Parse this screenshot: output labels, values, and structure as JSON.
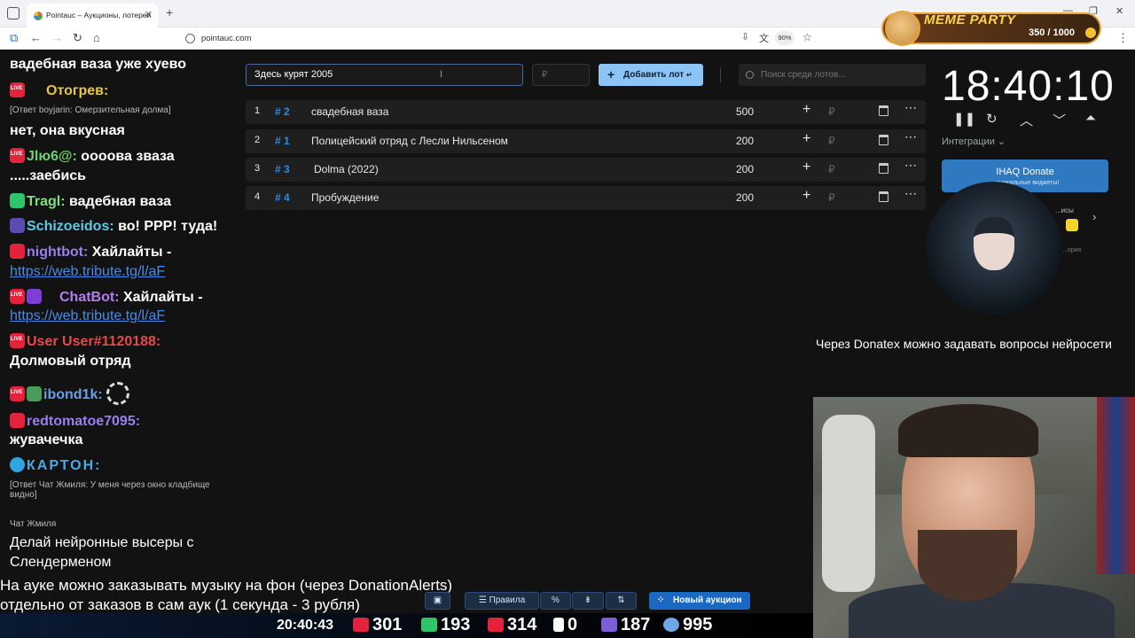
{
  "browser": {
    "tab_title": "Pointauc – Аукционы, лотереи",
    "url": "pointauc.com",
    "zoom": "90%"
  },
  "meme_party": {
    "title": "MEME PARTY",
    "count": "350 / 1000"
  },
  "chat": [
    {
      "user": "",
      "text": "вадебная ваза уже хуево"
    },
    {
      "user": "Отогрев:",
      "text": "",
      "color": "#e8c840"
    },
    {
      "reply": "[Ответ boyjarin: Омерзительная долма]"
    },
    {
      "user": "",
      "text": "нет, она вкусная"
    },
    {
      "user": "Jlю6@:",
      "text": "ооoова зваза",
      "color": "#6ad36a"
    },
    {
      "user": "",
      "text": ".....заебись"
    },
    {
      "user": "Tragl:",
      "text": "вадебная ваза",
      "color": "#7fe07f"
    },
    {
      "user": "Schizoeidos:",
      "text": "во! PPP! туда!",
      "color": "#5ec8e8"
    },
    {
      "user": "nightbot:",
      "text": "Хайлайты -",
      "color": "#9b7ef0"
    },
    {
      "link": "https://web.tribute.tg/l/aF"
    },
    {
      "user": "ChatBot:",
      "text": "Хайлайты -",
      "color": "#b57ef0"
    },
    {
      "link": "https://web.tribute.tg/l/aF"
    },
    {
      "user": "User User#1120188:",
      "text": "",
      "color": "#e84848"
    },
    {
      "user": "",
      "text": "Долмовый отряд"
    },
    {
      "user": "ibond1k:",
      "text": "",
      "color": "#6aa0e8"
    },
    {
      "user": "redtomatoe7095:",
      "text": "",
      "color": "#9b7ef0"
    },
    {
      "user": "",
      "text": "жувачечка"
    },
    {
      "user": "КАРТОН:",
      "text": "",
      "color": "#4aa8e8"
    },
    {
      "reply": "[Ответ Чат Жмиля: У меня через окно кладбище видно]"
    },
    {
      "reply": "Чат Жмиля"
    },
    {
      "user": "",
      "text": "Делай нейронные высеры с"
    },
    {
      "user": "",
      "text": "Слендерменом"
    }
  ],
  "lot_input": {
    "value": "Здесь курят 2005",
    "amount_placeholder": "₽"
  },
  "add_lot_label": "Добавить лот",
  "search_placeholder": "Поиск среди лотов...",
  "lots": [
    {
      "index": "1",
      "fast_id": "# 2",
      "name": "свадебная ваза",
      "amount": "500"
    },
    {
      "index": "2",
      "fast_id": "# 1",
      "name": "Полицейский отряд с Лесли Нильсеном",
      "amount": "200"
    },
    {
      "index": "3",
      "fast_id": "# 3",
      "name": "Dolma (2022)",
      "amount": "200"
    },
    {
      "index": "4",
      "fast_id": "# 4",
      "name": "Пробуждение",
      "amount": "200"
    }
  ],
  "currency_symbol": "₽",
  "timer": "18:40:10",
  "integrations_label": "Интеграции",
  "donate_button": {
    "label": "IHAQ Donate",
    "sub": "...уникальные виджеты!"
  },
  "side_text": "...исы",
  "side_small": "...ория",
  "overlay_donatex": "Через Donatex можно задавать вопросы нейросети",
  "bottom_text": [
    "На ауке можно заказывать музыку на фон (через DonationAlerts)",
    "отдельно от заказов в сам аук (1 секунда - 3 рубля)"
  ],
  "bottom_buttons": {
    "rules": "Правила",
    "new_auction": "Новый аукцион"
  },
  "stats": {
    "clock": "20:40:43",
    "youtube": "301",
    "kick": "193",
    "vk": "314",
    "r": "0",
    "twitch_like": "187",
    "viewers": "995"
  }
}
